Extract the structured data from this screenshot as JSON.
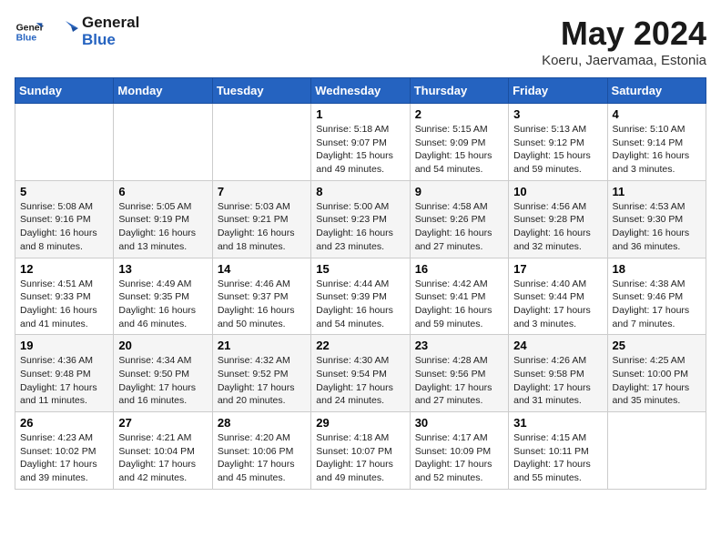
{
  "header": {
    "logo_line1": "General",
    "logo_line2": "Blue",
    "title": "May 2024",
    "subtitle": "Koeru, Jaervamaa, Estonia"
  },
  "days_of_week": [
    "Sunday",
    "Monday",
    "Tuesday",
    "Wednesday",
    "Thursday",
    "Friday",
    "Saturday"
  ],
  "weeks": [
    [
      {
        "day": "",
        "info": ""
      },
      {
        "day": "",
        "info": ""
      },
      {
        "day": "",
        "info": ""
      },
      {
        "day": "1",
        "info": "Sunrise: 5:18 AM\nSunset: 9:07 PM\nDaylight: 15 hours\nand 49 minutes."
      },
      {
        "day": "2",
        "info": "Sunrise: 5:15 AM\nSunset: 9:09 PM\nDaylight: 15 hours\nand 54 minutes."
      },
      {
        "day": "3",
        "info": "Sunrise: 5:13 AM\nSunset: 9:12 PM\nDaylight: 15 hours\nand 59 minutes."
      },
      {
        "day": "4",
        "info": "Sunrise: 5:10 AM\nSunset: 9:14 PM\nDaylight: 16 hours\nand 3 minutes."
      }
    ],
    [
      {
        "day": "5",
        "info": "Sunrise: 5:08 AM\nSunset: 9:16 PM\nDaylight: 16 hours\nand 8 minutes."
      },
      {
        "day": "6",
        "info": "Sunrise: 5:05 AM\nSunset: 9:19 PM\nDaylight: 16 hours\nand 13 minutes."
      },
      {
        "day": "7",
        "info": "Sunrise: 5:03 AM\nSunset: 9:21 PM\nDaylight: 16 hours\nand 18 minutes."
      },
      {
        "day": "8",
        "info": "Sunrise: 5:00 AM\nSunset: 9:23 PM\nDaylight: 16 hours\nand 23 minutes."
      },
      {
        "day": "9",
        "info": "Sunrise: 4:58 AM\nSunset: 9:26 PM\nDaylight: 16 hours\nand 27 minutes."
      },
      {
        "day": "10",
        "info": "Sunrise: 4:56 AM\nSunset: 9:28 PM\nDaylight: 16 hours\nand 32 minutes."
      },
      {
        "day": "11",
        "info": "Sunrise: 4:53 AM\nSunset: 9:30 PM\nDaylight: 16 hours\nand 36 minutes."
      }
    ],
    [
      {
        "day": "12",
        "info": "Sunrise: 4:51 AM\nSunset: 9:33 PM\nDaylight: 16 hours\nand 41 minutes."
      },
      {
        "day": "13",
        "info": "Sunrise: 4:49 AM\nSunset: 9:35 PM\nDaylight: 16 hours\nand 46 minutes."
      },
      {
        "day": "14",
        "info": "Sunrise: 4:46 AM\nSunset: 9:37 PM\nDaylight: 16 hours\nand 50 minutes."
      },
      {
        "day": "15",
        "info": "Sunrise: 4:44 AM\nSunset: 9:39 PM\nDaylight: 16 hours\nand 54 minutes."
      },
      {
        "day": "16",
        "info": "Sunrise: 4:42 AM\nSunset: 9:41 PM\nDaylight: 16 hours\nand 59 minutes."
      },
      {
        "day": "17",
        "info": "Sunrise: 4:40 AM\nSunset: 9:44 PM\nDaylight: 17 hours\nand 3 minutes."
      },
      {
        "day": "18",
        "info": "Sunrise: 4:38 AM\nSunset: 9:46 PM\nDaylight: 17 hours\nand 7 minutes."
      }
    ],
    [
      {
        "day": "19",
        "info": "Sunrise: 4:36 AM\nSunset: 9:48 PM\nDaylight: 17 hours\nand 11 minutes."
      },
      {
        "day": "20",
        "info": "Sunrise: 4:34 AM\nSunset: 9:50 PM\nDaylight: 17 hours\nand 16 minutes."
      },
      {
        "day": "21",
        "info": "Sunrise: 4:32 AM\nSunset: 9:52 PM\nDaylight: 17 hours\nand 20 minutes."
      },
      {
        "day": "22",
        "info": "Sunrise: 4:30 AM\nSunset: 9:54 PM\nDaylight: 17 hours\nand 24 minutes."
      },
      {
        "day": "23",
        "info": "Sunrise: 4:28 AM\nSunset: 9:56 PM\nDaylight: 17 hours\nand 27 minutes."
      },
      {
        "day": "24",
        "info": "Sunrise: 4:26 AM\nSunset: 9:58 PM\nDaylight: 17 hours\nand 31 minutes."
      },
      {
        "day": "25",
        "info": "Sunrise: 4:25 AM\nSunset: 10:00 PM\nDaylight: 17 hours\nand 35 minutes."
      }
    ],
    [
      {
        "day": "26",
        "info": "Sunrise: 4:23 AM\nSunset: 10:02 PM\nDaylight: 17 hours\nand 39 minutes."
      },
      {
        "day": "27",
        "info": "Sunrise: 4:21 AM\nSunset: 10:04 PM\nDaylight: 17 hours\nand 42 minutes."
      },
      {
        "day": "28",
        "info": "Sunrise: 4:20 AM\nSunset: 10:06 PM\nDaylight: 17 hours\nand 45 minutes."
      },
      {
        "day": "29",
        "info": "Sunrise: 4:18 AM\nSunset: 10:07 PM\nDaylight: 17 hours\nand 49 minutes."
      },
      {
        "day": "30",
        "info": "Sunrise: 4:17 AM\nSunset: 10:09 PM\nDaylight: 17 hours\nand 52 minutes."
      },
      {
        "day": "31",
        "info": "Sunrise: 4:15 AM\nSunset: 10:11 PM\nDaylight: 17 hours\nand 55 minutes."
      },
      {
        "day": "",
        "info": ""
      }
    ]
  ]
}
